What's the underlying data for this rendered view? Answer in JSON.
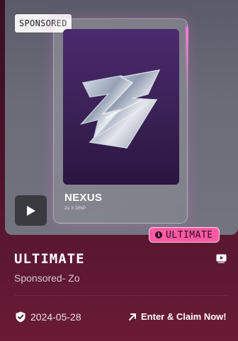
{
  "hero": {
    "sponsored_tag": "SPONSORED",
    "nft_name": "NEXUS",
    "nft_subtitle": "Zo X DRiP"
  },
  "badge": {
    "dot": "1",
    "label": "ULTIMATE"
  },
  "info": {
    "title": "ULTIMATE",
    "subtitle": "Sponsored- Zo",
    "date": "2024-05-28",
    "claim_label": "Enter & Claim Now!"
  },
  "icons": {
    "play": "play-icon",
    "video": "video-icon",
    "shield": "shield-check-icon",
    "arrow": "arrow-up-right-icon",
    "logo": "z-logo-icon"
  },
  "colors": {
    "accent_pink": "#ff5aa5",
    "card_bg": "#4a1228",
    "text_white": "#ffffff"
  }
}
